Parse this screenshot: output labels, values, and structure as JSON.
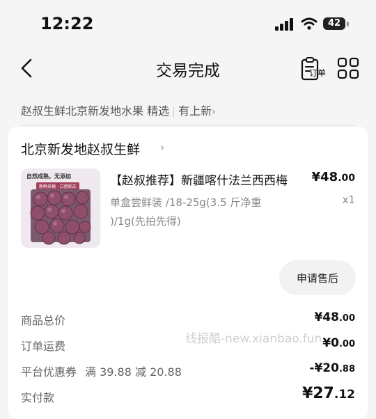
{
  "status_bar": {
    "time": "12:22",
    "battery": "42"
  },
  "nav": {
    "title": "交易完成",
    "order_label": "订单"
  },
  "shop_bar": {
    "text": "赵叔生鲜北京新发地水果 精选",
    "link": "有上新"
  },
  "store": {
    "name": "北京新发地赵叔生鲜"
  },
  "product": {
    "thumb_caption": "自然成熟，无添加",
    "thumb_tag": "新鲜采摘 · 口感纯正",
    "title": "【赵叔推荐】新疆喀什法兰西西梅",
    "price_main": "¥48",
    "price_cents": ".00",
    "spec": "单盒尝鲜装 /18-25g(3.5 斤净重 )/1g(先拍先得)",
    "quantity": "x1"
  },
  "actions": {
    "after_sales": "申请售后"
  },
  "summary": {
    "goods_total_label": "商品总价",
    "goods_total_main": "¥48",
    "goods_total_cents": ".00",
    "shipping_label": "订单运费",
    "shipping_main": "¥0",
    "shipping_cents": ".00",
    "coupon_label": "平台优惠券",
    "coupon_note": "满 39.88 减 20.88",
    "coupon_main": "-¥20",
    "coupon_cents": ".88",
    "paid_label": "实付款",
    "paid_main": "¥27",
    "paid_cents": ".12"
  },
  "watermark": "线报酷-new.xianbao.fun"
}
